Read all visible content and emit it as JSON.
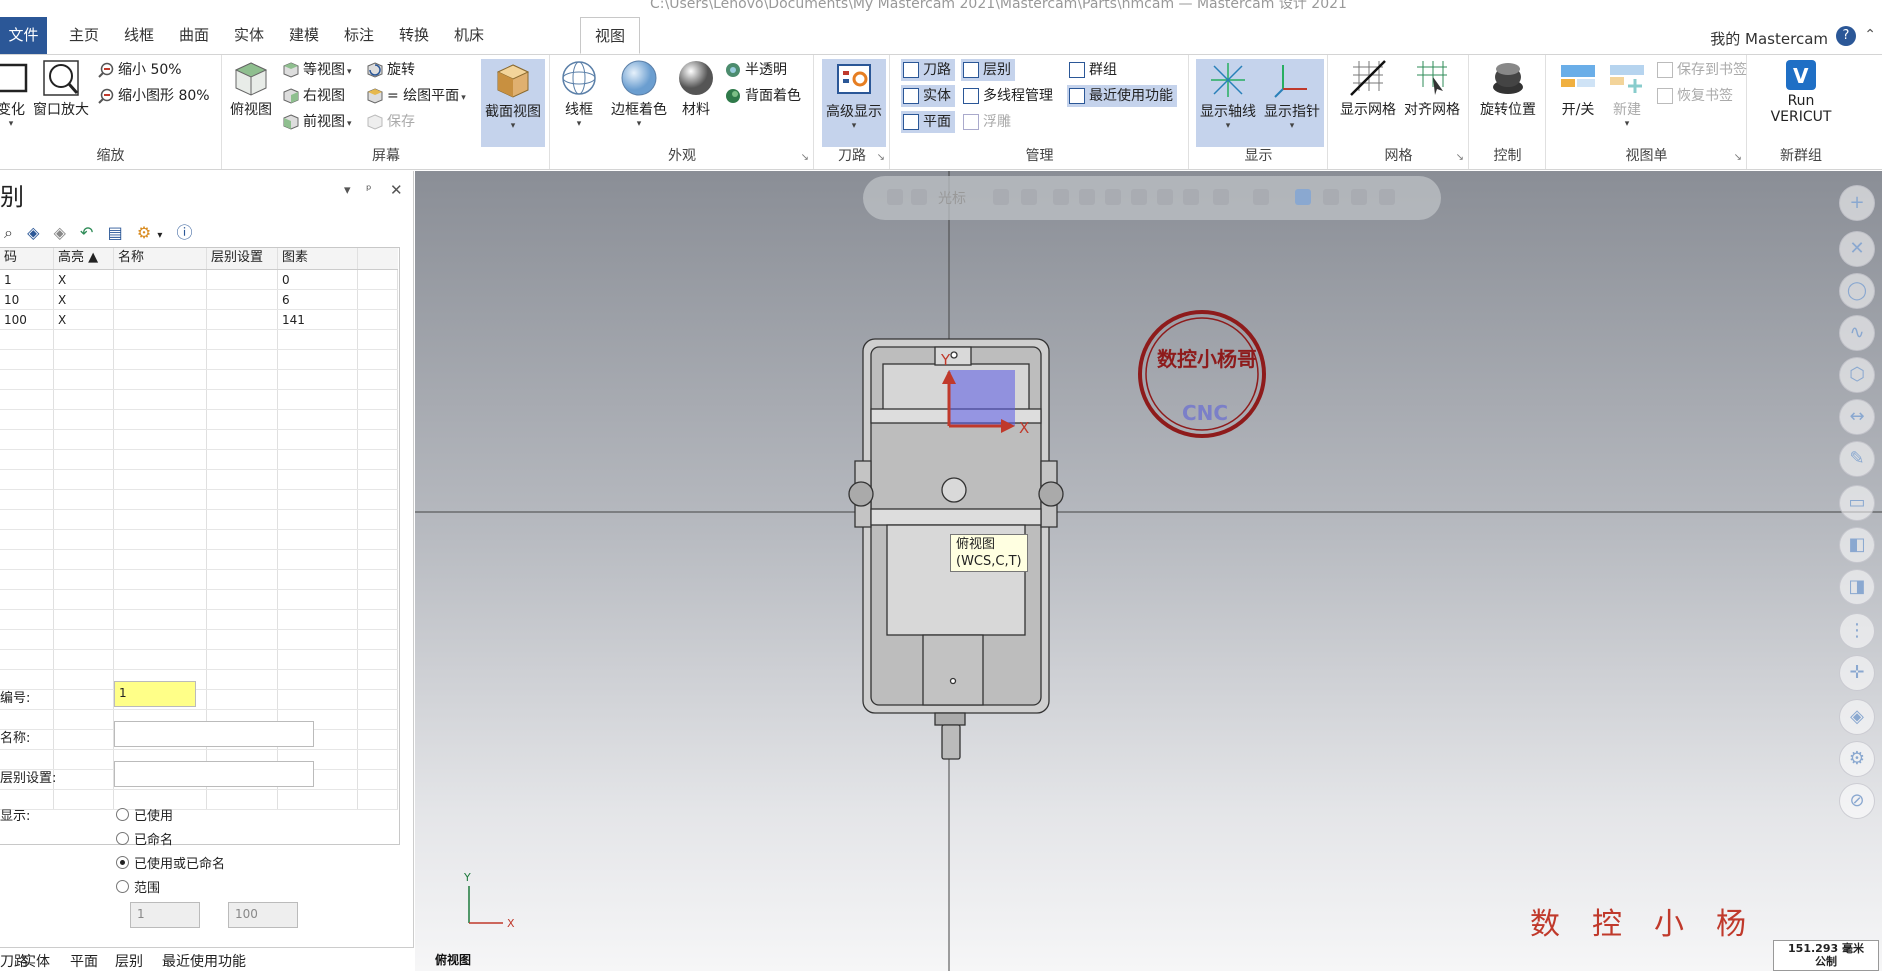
{
  "window": {
    "title": "C:\\Users\\Lenovo\\Documents\\My Mastercam 2021\\Mastercam\\Parts\\nmcam — Mastercam 设计 2021"
  },
  "tabs": {
    "file": "文件",
    "items": [
      "主页",
      "线框",
      "曲面",
      "实体",
      "建模",
      "标注",
      "转换",
      "机床",
      "视图"
    ],
    "active": "视图",
    "account": "我的 Mastercam"
  },
  "ribbon": {
    "zoom": {
      "label": "缩放",
      "btn_fit": "变化",
      "btn_window": "窗口放大",
      "shrink50": "缩小 50%",
      "shrink80": "缩小图形 80%"
    },
    "screen": {
      "label": "屏幕",
      "top": "俯视图",
      "iso": "等视图",
      "right": "右视图",
      "front": "前视图",
      "rotate": "旋转",
      "eqplane": "= 绘图平面",
      "save": "保存",
      "section": "截面视图"
    },
    "appearance": {
      "label": "外观",
      "wire": "线框",
      "edges": "边框着色",
      "material": "材料",
      "translucent": "半透明",
      "backcolor": "背面着色"
    },
    "toolpath": {
      "label": "刀路",
      "advanced": "高级显示"
    },
    "manage": {
      "label": "管理",
      "toolpath": "刀路",
      "layers": "层别",
      "groups": "群组",
      "solids": "实体",
      "multithread": "多线程管理",
      "recent": "最近使用功能",
      "planes": "平面",
      "relief": "浮雕"
    },
    "display": {
      "label": "显示",
      "axes": "显示轴线",
      "gnomon": "显示指针"
    },
    "grid": {
      "label": "网格",
      "show": "显示网格",
      "snap": "对齐网格"
    },
    "control": {
      "label": "控制",
      "rotpos": "旋转位置"
    },
    "viewsheets": {
      "label": "视图单",
      "toggle": "开/关",
      "new": "新建",
      "save_bm": "保存到书签",
      "restore_bm": "恢复书签"
    },
    "addin": {
      "label": "新群组",
      "vericut1": "Run",
      "vericut2": "VERICUT"
    }
  },
  "panel": {
    "title": "别",
    "columns": [
      "码",
      "高亮 ▲",
      "名称",
      "层别设置",
      "图素"
    ],
    "rows": [
      {
        "num": "1",
        "hl": "X",
        "name": "",
        "set": "",
        "count": "0",
        "mark": "✓"
      },
      {
        "num": "10",
        "hl": "X",
        "name": "",
        "set": "",
        "count": "6",
        "mark": ""
      },
      {
        "num": "100",
        "hl": "X",
        "name": "",
        "set": "",
        "count": "141",
        "mark": ""
      }
    ],
    "form": {
      "num_label": "编号:",
      "num_value": "1",
      "name_label": "名称:",
      "name_value": "",
      "set_label": "层别设置:",
      "set_value": "",
      "show_label": "显示:",
      "opt_used": "已使用",
      "opt_named": "已命名",
      "opt_both": "已使用或已命名",
      "opt_range": "范围",
      "selected": "已使用或已命名",
      "range_from": "1",
      "range_to": "100"
    },
    "bottom_tabs": [
      "刀路",
      "实体",
      "平面",
      "层别",
      "最近使用功能"
    ]
  },
  "viewport": {
    "toolbar_label": "光标",
    "tooltip_line1": "俯视图",
    "tooltip_line2": "(WCS,C,T)",
    "axis_x": "X",
    "axis_y": "Y",
    "view_name": "俯视图",
    "stamp_top": "数控小杨哥",
    "stamp_bottom": "CNC",
    "watermark": "数控小杨",
    "scale_value": "151.293 毫米",
    "scale_unit": "公制"
  },
  "colors": {
    "accent": "#2b5797",
    "selected": "#c5d3ec",
    "stamp": "#8e1b1b",
    "watermark": "#c0392b"
  }
}
